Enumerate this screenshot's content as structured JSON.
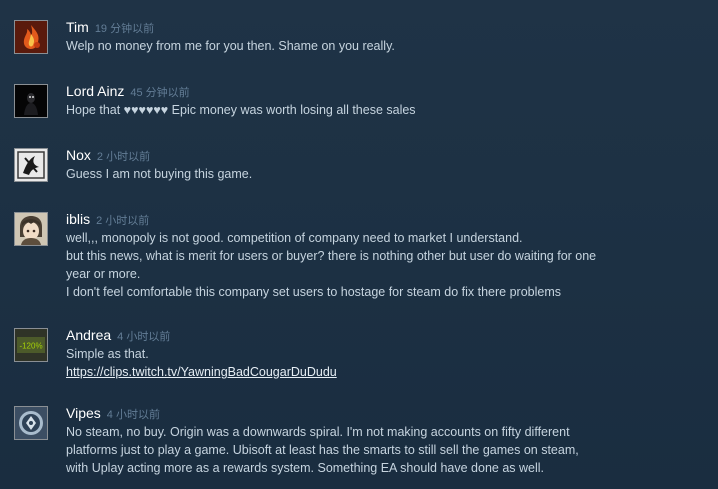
{
  "comments": [
    {
      "author": "Tim",
      "time": "19 分钟以前",
      "avatar_icon": "flame-avatar-icon",
      "lines": [
        "Welp no money from me for you then. Shame on you really."
      ]
    },
    {
      "author": "Lord Ainz",
      "time": "45 分钟以前",
      "avatar_icon": "dark-figure-avatar-icon",
      "lines": [
        "Hope that ♥♥♥♥♥♥ Epic money was worth losing all these sales"
      ]
    },
    {
      "author": "Nox",
      "time": "2 小时以前",
      "avatar_icon": "emblem-avatar-icon",
      "lines": [
        "Guess I am not buying this game."
      ]
    },
    {
      "author": "iblis",
      "time": "2 小时以前",
      "avatar_icon": "anime-character-avatar-icon",
      "lines": [
        "well,,, monopoly is not good. competition of company need to market I understand.",
        "but this news, what is merit for users or buyer? there is nothing other but user do waiting for one",
        "year or more.",
        "I don't feel comfortable this company set users to hostage for steam do fix there problems"
      ]
    },
    {
      "author": "Andrea",
      "time": "4 小时以前",
      "avatar_icon": "discount-badge-avatar-icon",
      "avatar_text": "-120%",
      "lines": [
        "Simple as that."
      ],
      "link": "https://clips.twitch.tv/YawningBadCougarDuDudu"
    },
    {
      "author": "Vipes",
      "time": "4 小时以前",
      "avatar_icon": "crest-avatar-icon",
      "lines": [
        "No steam, no buy. Origin was a downwards spiral. I'm not making accounts on fifty different",
        "platforms just to play a game. Ubisoft at least has the smarts to still sell the games on steam,",
        "with Uplay acting more as a rewards system. Something EA should have done as well."
      ]
    }
  ]
}
